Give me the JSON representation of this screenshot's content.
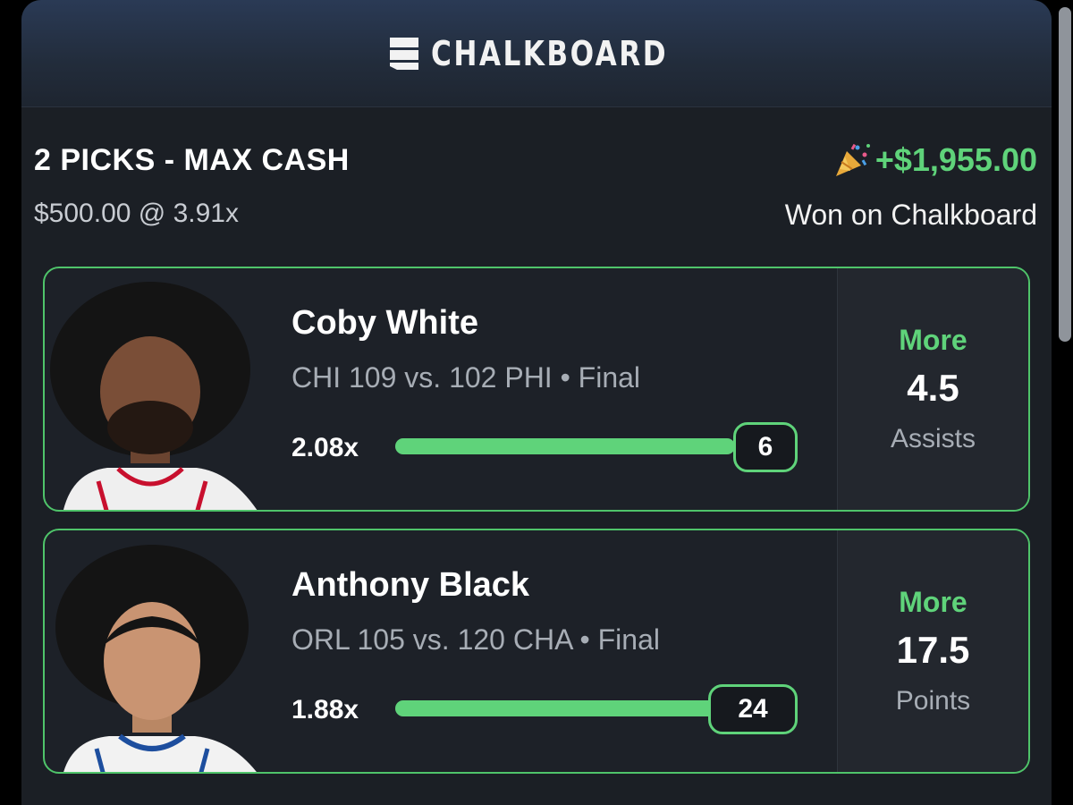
{
  "app": {
    "brand": "CHALKBOARD"
  },
  "summary": {
    "title": "2 PICKS - MAX CASH",
    "stake": "$500.00 @ 3.91x",
    "payout": "+$1,955.00",
    "payout_icon": "party-popper-icon",
    "won_label": "Won on Chalkboard"
  },
  "picks": [
    {
      "player": "Coby White",
      "game": "CHI 109 vs. 102 PHI • Final",
      "multiplier": "2.08x",
      "result": "6",
      "progress": 1.0,
      "direction": "More",
      "line": "4.5",
      "stat": "Assists"
    },
    {
      "player": "Anthony Black",
      "game": "ORL 105 vs. 120 CHA • Final",
      "multiplier": "1.88x",
      "result": "24",
      "progress": 1.0,
      "direction": "More",
      "line": "17.5",
      "stat": "Points"
    }
  ],
  "colors": {
    "accent_green": "#5fd37a",
    "background": "#1b1f25",
    "card_border": "#4fc46a"
  }
}
